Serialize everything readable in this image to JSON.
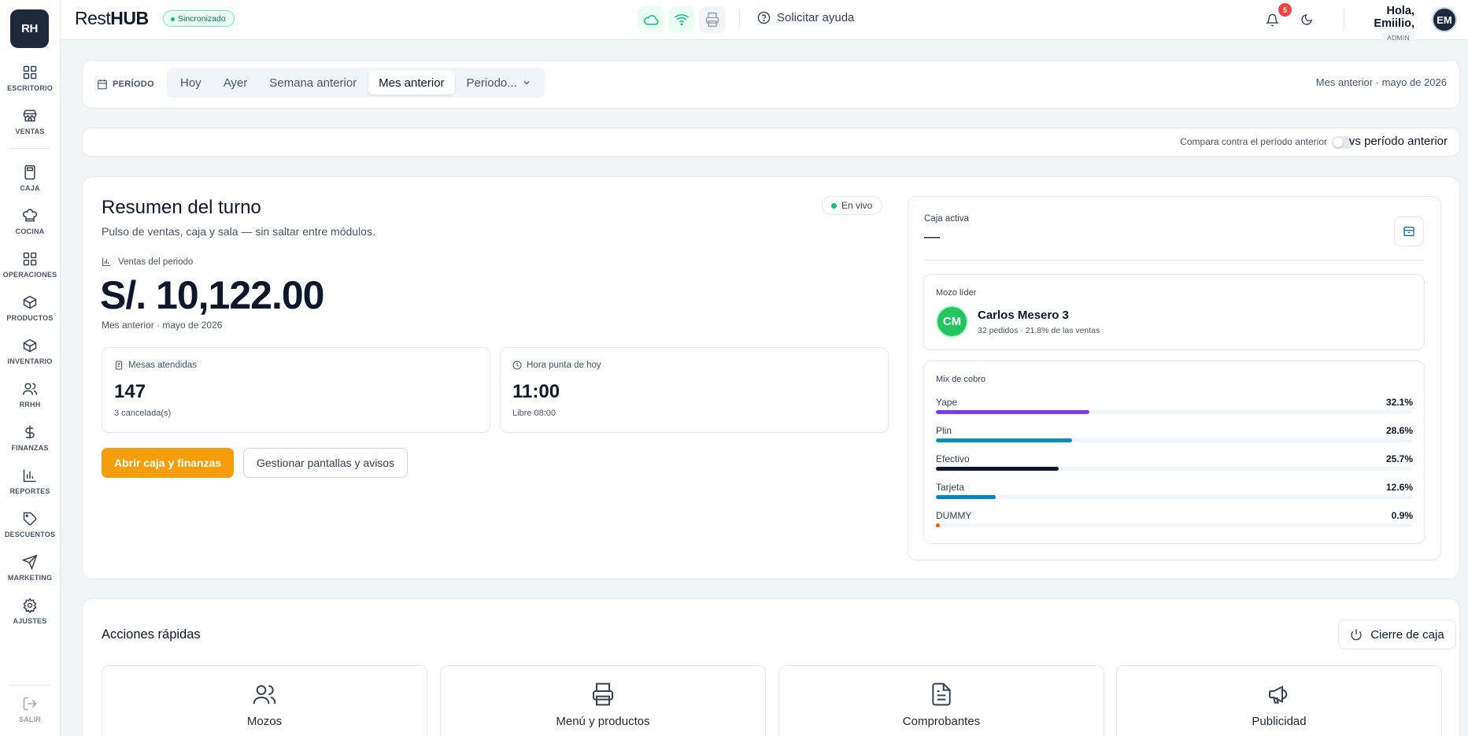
{
  "sidebar": {
    "logo": "RH",
    "items": [
      {
        "label": "ESCRITORIO",
        "icon": "grid-icon"
      },
      {
        "label": "VENTAS",
        "icon": "store-icon"
      },
      {
        "label": "CAJA",
        "icon": "calculator-icon"
      },
      {
        "label": "COCINA",
        "icon": "chef-hat-icon"
      },
      {
        "label": "OPERACIONES",
        "icon": "grid-icon"
      },
      {
        "label": "PRODUCTOS",
        "icon": "box-icon"
      },
      {
        "label": "INVENTARIO",
        "icon": "box-icon"
      },
      {
        "label": "RRHH",
        "icon": "users-icon"
      },
      {
        "label": "FINANZAS",
        "icon": "dollar-icon"
      },
      {
        "label": "REPORTES",
        "icon": "bar-chart-icon"
      },
      {
        "label": "DESCUENTOS",
        "icon": "tag-icon"
      },
      {
        "label": "MARKETING",
        "icon": "send-icon"
      },
      {
        "label": "AJUSTES",
        "icon": "gear-icon"
      }
    ],
    "logout_label": "SALIR"
  },
  "topbar": {
    "brand_light": "Rest",
    "brand_bold": "HUB",
    "sync_status": "Sincronizado",
    "help_label": "Solicitar ayuda",
    "notifications_count": "5",
    "greeting": "Hola, Emiilio,",
    "role": "ADMIN",
    "avatar_initials": "EM"
  },
  "period": {
    "label": "PERÍODO",
    "options": [
      "Hoy",
      "Ayer",
      "Semana anterior",
      "Mes anterior",
      "Periodo..."
    ],
    "selected": "Mes anterior",
    "summary": "Mes anterior · mayo de 2026"
  },
  "compare": {
    "hint": "Compara contra el período anterior",
    "label": "vs período anterior",
    "enabled": false
  },
  "resumen": {
    "title": "Resumen del turno",
    "subtitle": "Pulso de ventas, caja y sala — sin saltar entre módulos.",
    "live_label": "En vivo",
    "sales_label": "Ventas del periodo",
    "sales_amount": "S/. 10,122.00",
    "sales_period": "Mes anterior · mayo de 2026",
    "mesas": {
      "label": "Mesas atendidas",
      "value": "147",
      "sub": "3 cancelada(s)"
    },
    "hora_punta": {
      "label": "Hora punta de hoy",
      "value": "11:00",
      "sub": "Libre 08:00"
    },
    "primary_button": "Abrir caja y finanzas",
    "secondary_button": "Gestionar pantallas y avisos"
  },
  "caja": {
    "label": "Caja activa",
    "value": "—"
  },
  "mozo": {
    "label": "Mozo líder",
    "initials": "CM",
    "name": "Carlos Mesero 3",
    "stats": "32 pedidos · 21.8% de las ventas"
  },
  "mix": {
    "label": "Mix de cobro",
    "rows": [
      {
        "name": "Yape",
        "percent_label": "32.1%",
        "value": 32.1,
        "color": "#7c3aed"
      },
      {
        "name": "Plin",
        "percent_label": "28.6%",
        "value": 28.6,
        "color": "#0891b2"
      },
      {
        "name": "Efectivo",
        "percent_label": "25.7%",
        "value": 25.7,
        "color": "#0f172a"
      },
      {
        "name": "Tarjeta",
        "percent_label": "12.6%",
        "value": 12.6,
        "color": "#0284c7"
      },
      {
        "name": "DUMMY",
        "percent_label": "0.9%",
        "value": 0.9,
        "color": "#ea580c"
      }
    ]
  },
  "acciones": {
    "title": "Acciones rápidas",
    "cierre_label": "Cierre de caja",
    "items": [
      {
        "label": "Mozos",
        "icon": "users-icon"
      },
      {
        "label": "Menú y productos",
        "icon": "printer-icon"
      },
      {
        "label": "Comprobantes",
        "icon": "document-icon"
      },
      {
        "label": "Publicidad",
        "icon": "megaphone-icon"
      }
    ]
  }
}
